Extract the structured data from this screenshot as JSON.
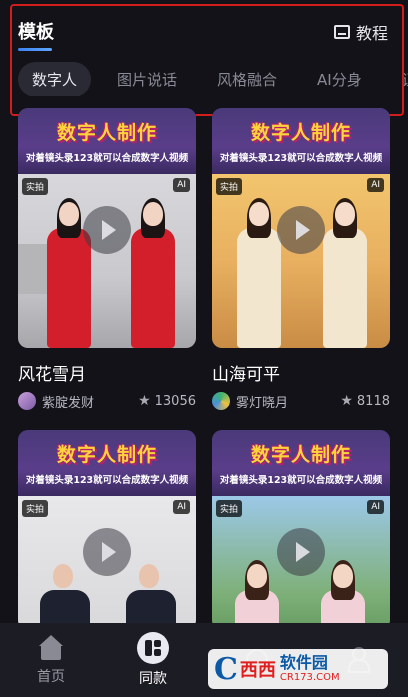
{
  "header": {
    "title": "模板",
    "tutorial_label": "教程",
    "tutorial_icon": "book-icon"
  },
  "tabs": [
    {
      "label": "数字人",
      "active": true
    },
    {
      "label": "图片说话",
      "active": false
    },
    {
      "label": "风格融合",
      "active": false
    },
    {
      "label": "AI分身",
      "active": false
    },
    {
      "label": "证",
      "active": false
    }
  ],
  "cards": [
    {
      "banner_title": "数字人制作",
      "banner_subtitle": "对着镜头录123就可以合成数字人视频",
      "tag_left": "实拍",
      "tag_right": "AI",
      "title": "风花雪月",
      "author": "紫腚发财",
      "stars": "13056"
    },
    {
      "banner_title": "数字人制作",
      "banner_subtitle": "对着镜头录123就可以合成数字人视频",
      "tag_left": "实拍",
      "tag_right": "AI",
      "title": "山海可平",
      "author": "雾灯晓月",
      "stars": "8118"
    },
    {
      "banner_title": "数字人制作",
      "banner_subtitle": "对着镜头录123就可以合成数字人视频",
      "tag_left": "实拍",
      "tag_right": "AI"
    },
    {
      "banner_title": "数字人制作",
      "banner_subtitle": "对着镜头录123就可以合成数字人视频",
      "tag_left": "实拍",
      "tag_right": "AI"
    }
  ],
  "bottom_nav": [
    {
      "label": "首页",
      "icon": "home-icon",
      "active": false
    },
    {
      "label": "同款",
      "icon": "same-style-icon",
      "active": true
    },
    {
      "label": "",
      "icon": "create-icon",
      "active": false
    },
    {
      "label": "",
      "icon": "profile-icon",
      "active": false
    }
  ],
  "watermark": {
    "logo_letter": "C",
    "logo_mark": "西西",
    "name": "软件园",
    "url": "CR173.COM"
  },
  "colors": {
    "background": "#121218",
    "accent": "#3b82f6",
    "highlight_box": "#d21d1d",
    "banner_title": "#ffd43b"
  }
}
